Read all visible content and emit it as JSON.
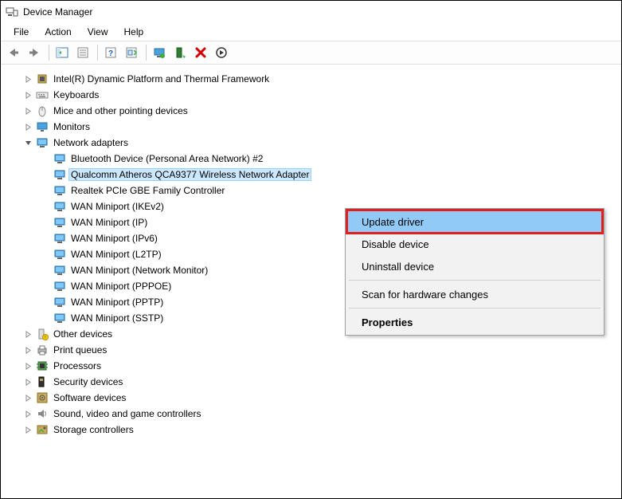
{
  "window": {
    "title": "Device Manager"
  },
  "menu": {
    "file": "File",
    "action": "Action",
    "view": "View",
    "help": "Help"
  },
  "context_menu": {
    "update_driver": "Update driver",
    "disable_device": "Disable device",
    "uninstall_device": "Uninstall device",
    "scan_hardware": "Scan for hardware changes",
    "properties": "Properties"
  },
  "tree": [
    {
      "level": 1,
      "expander": "collapsed",
      "icon": "chip",
      "label": "Intel(R) Dynamic Platform and Thermal Framework"
    },
    {
      "level": 1,
      "expander": "collapsed",
      "icon": "keyboard",
      "label": "Keyboards"
    },
    {
      "level": 1,
      "expander": "collapsed",
      "icon": "mouse",
      "label": "Mice and other pointing devices"
    },
    {
      "level": 1,
      "expander": "collapsed",
      "icon": "monitor",
      "label": "Monitors"
    },
    {
      "level": 1,
      "expander": "expanded",
      "icon": "network",
      "label": "Network adapters"
    },
    {
      "level": 2,
      "expander": "none",
      "icon": "network",
      "label": "Bluetooth Device (Personal Area Network) #2"
    },
    {
      "level": 2,
      "expander": "none",
      "icon": "network",
      "label": "Qualcomm Atheros QCA9377 Wireless Network Adapter",
      "selected": true
    },
    {
      "level": 2,
      "expander": "none",
      "icon": "network",
      "label": "Realtek PCIe GBE Family Controller"
    },
    {
      "level": 2,
      "expander": "none",
      "icon": "network",
      "label": "WAN Miniport (IKEv2)"
    },
    {
      "level": 2,
      "expander": "none",
      "icon": "network",
      "label": "WAN Miniport (IP)"
    },
    {
      "level": 2,
      "expander": "none",
      "icon": "network",
      "label": "WAN Miniport (IPv6)"
    },
    {
      "level": 2,
      "expander": "none",
      "icon": "network",
      "label": "WAN Miniport (L2TP)"
    },
    {
      "level": 2,
      "expander": "none",
      "icon": "network",
      "label": "WAN Miniport (Network Monitor)"
    },
    {
      "level": 2,
      "expander": "none",
      "icon": "network",
      "label": "WAN Miniport (PPPOE)"
    },
    {
      "level": 2,
      "expander": "none",
      "icon": "network",
      "label": "WAN Miniport (PPTP)"
    },
    {
      "level": 2,
      "expander": "none",
      "icon": "network",
      "label": "WAN Miniport (SSTP)"
    },
    {
      "level": 1,
      "expander": "collapsed",
      "icon": "other",
      "label": "Other devices"
    },
    {
      "level": 1,
      "expander": "collapsed",
      "icon": "printer",
      "label": "Print queues"
    },
    {
      "level": 1,
      "expander": "collapsed",
      "icon": "cpu",
      "label": "Processors"
    },
    {
      "level": 1,
      "expander": "collapsed",
      "icon": "security",
      "label": "Security devices"
    },
    {
      "level": 1,
      "expander": "collapsed",
      "icon": "software",
      "label": "Software devices"
    },
    {
      "level": 1,
      "expander": "collapsed",
      "icon": "audio",
      "label": "Sound, video and game controllers"
    },
    {
      "level": 1,
      "expander": "collapsed",
      "icon": "storage",
      "label": "Storage controllers"
    }
  ]
}
